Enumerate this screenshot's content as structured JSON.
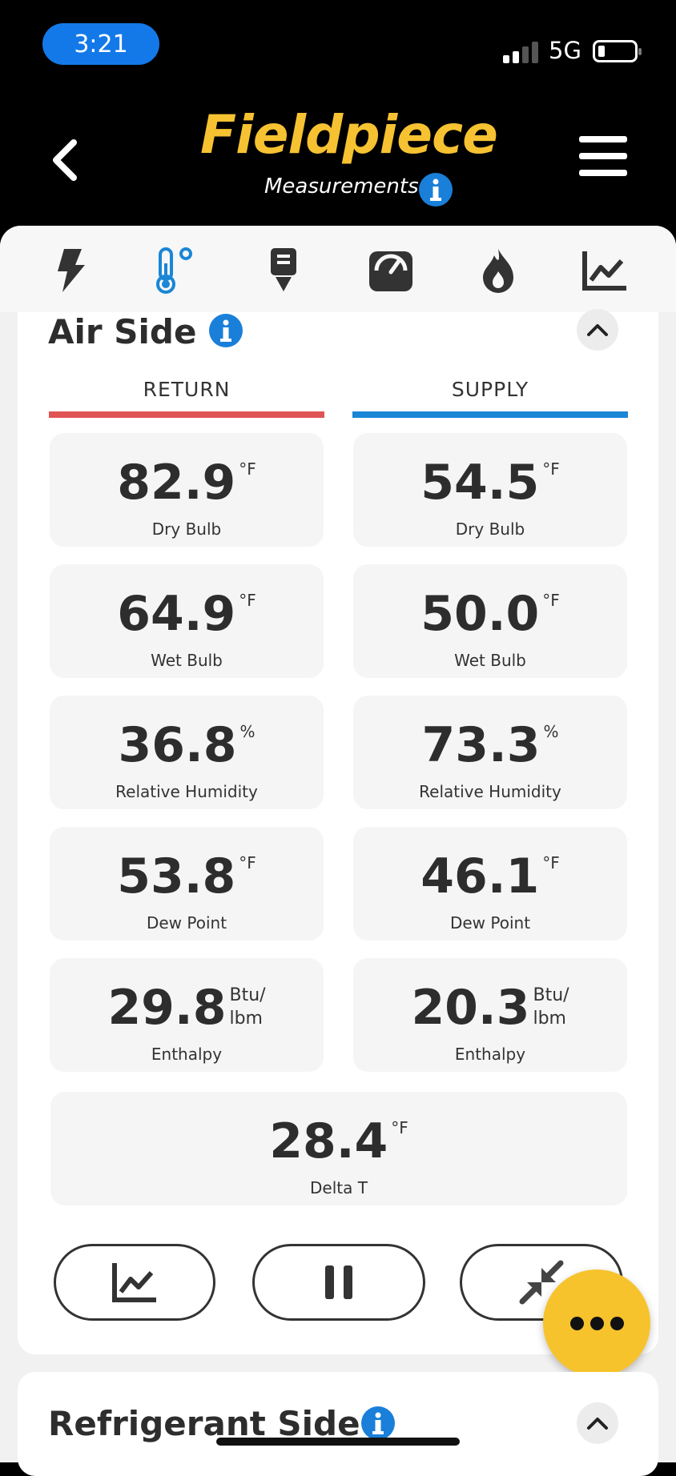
{
  "status_bar": {
    "time": "3:21",
    "network": "5G"
  },
  "header": {
    "logo": "Fieldpiece",
    "subtitle": "Measurements"
  },
  "tabs": [
    "lightning-icon",
    "thermometer-icon",
    "drain-icon",
    "gauge-icon",
    "flame-icon",
    "trend-chart-icon"
  ],
  "air_side": {
    "title": "Air Side",
    "return_label": "RETURN",
    "supply_label": "SUPPLY",
    "return": [
      {
        "value": "82.9",
        "unit": "°F",
        "label": "Dry Bulb"
      },
      {
        "value": "64.9",
        "unit": "°F",
        "label": "Wet Bulb"
      },
      {
        "value": "36.8",
        "unit": "%",
        "label": "Relative Humidity"
      },
      {
        "value": "53.8",
        "unit": "°F",
        "label": "Dew Point"
      },
      {
        "value": "29.8",
        "unit_line1": "Btu/",
        "unit_line2": "lbm",
        "label": "Enthalpy"
      }
    ],
    "supply": [
      {
        "value": "54.5",
        "unit": "°F",
        "label": "Dry Bulb"
      },
      {
        "value": "50.0",
        "unit": "°F",
        "label": "Wet Bulb"
      },
      {
        "value": "73.3",
        "unit": "%",
        "label": "Relative Humidity"
      },
      {
        "value": "46.1",
        "unit": "°F",
        "label": "Dew Point"
      },
      {
        "value": "20.3",
        "unit_line1": "Btu/",
        "unit_line2": "lbm",
        "label": "Enthalpy"
      }
    ],
    "delta": {
      "value": "28.4",
      "unit": "°F",
      "label": "Delta T"
    }
  },
  "refrigerant_side": {
    "title": "Refrigerant Side"
  },
  "colors": {
    "accent_yellow": "#f6c231",
    "return_red": "#e05454",
    "supply_blue": "#1a86d6",
    "info_blue": "#1a7fd9"
  }
}
